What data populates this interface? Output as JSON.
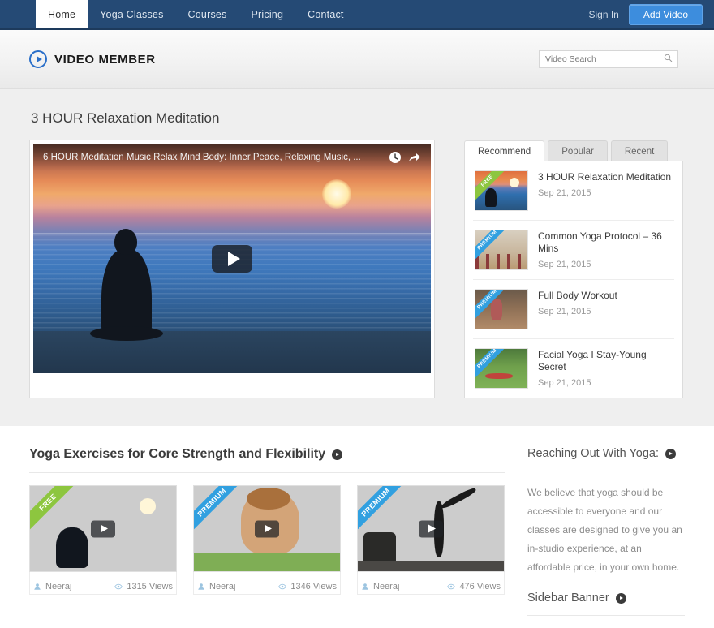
{
  "navbar": {
    "items": [
      {
        "label": "Home",
        "active": true
      },
      {
        "label": "Yoga Classes",
        "active": false
      },
      {
        "label": "Courses",
        "active": false
      },
      {
        "label": "Pricing",
        "active": false
      },
      {
        "label": "Contact",
        "active": false
      }
    ],
    "sign_in": "Sign In",
    "add_video": "Add Video",
    "bg_color": "#254a75",
    "button_color": "#3d8ddd"
  },
  "header": {
    "logo_text_1": "VIDEO ",
    "logo_text_2": "MEMBER",
    "logo_icon": "play-circle-icon",
    "search": {
      "placeholder": "Video Search",
      "value": "",
      "icon": "search-icon"
    }
  },
  "main": {
    "page_title": "3 HOUR Relaxation Meditation",
    "player": {
      "overlay_title": "6 HOUR Meditation Music Relax Mind Body: Inner Peace, Relaxing Music, ...",
      "watch_later_icon": "clock-icon",
      "share_icon": "share-arrow-icon",
      "play_icon": "play-icon"
    }
  },
  "sidebar": {
    "tabs": [
      {
        "label": "Recommend",
        "active": true
      },
      {
        "label": "Popular",
        "active": false
      },
      {
        "label": "Recent",
        "active": false
      }
    ],
    "items": [
      {
        "title": "3 HOUR Relaxation Meditation",
        "date": "Sep 21, 2015",
        "ribbon": "FREE",
        "ribbon_type": "free",
        "art": "art-medit"
      },
      {
        "title": "Common Yoga Protocol – 36 Mins",
        "date": "Sep 21, 2015",
        "ribbon": "PREMIUM",
        "ribbon_type": "premium",
        "art": "art-group"
      },
      {
        "title": "Full Body Workout",
        "date": "Sep 21, 2015",
        "ribbon": "PREMIUM",
        "ribbon_type": "premium",
        "art": "art-gym"
      },
      {
        "title": "Facial Yoga I Stay-Young Secret",
        "date": "Sep 21, 2015",
        "ribbon": "PREMIUM",
        "ribbon_type": "premium",
        "art": "art-lawn"
      }
    ]
  },
  "bottom": {
    "section_title": "Yoga Exercises for Core Strength and Flexibility",
    "cards": [
      {
        "ribbon": "FREE",
        "ribbon_type": "free",
        "author": "Neeraj",
        "views": "1315 Views",
        "art": "art-medit"
      },
      {
        "ribbon": "PREMIUM",
        "ribbon_type": "premium",
        "author": "Neeraj",
        "views": "1346 Views",
        "art": "art-yogalady"
      },
      {
        "ribbon": "PREMIUM",
        "ribbon_type": "premium",
        "author": "Neeraj",
        "views": "476 Views",
        "art": "art-handstand"
      }
    ],
    "author_icon": "user-icon",
    "views_icon": "eye-icon"
  },
  "right_column": {
    "title": "Reaching Out With Yoga:",
    "body": "We believe that yoga should be accessible to everyone and our classes are designed to give you an in-studio experience, at an affordable price, in your own home.",
    "banner_title": "Sidebar Banner"
  }
}
